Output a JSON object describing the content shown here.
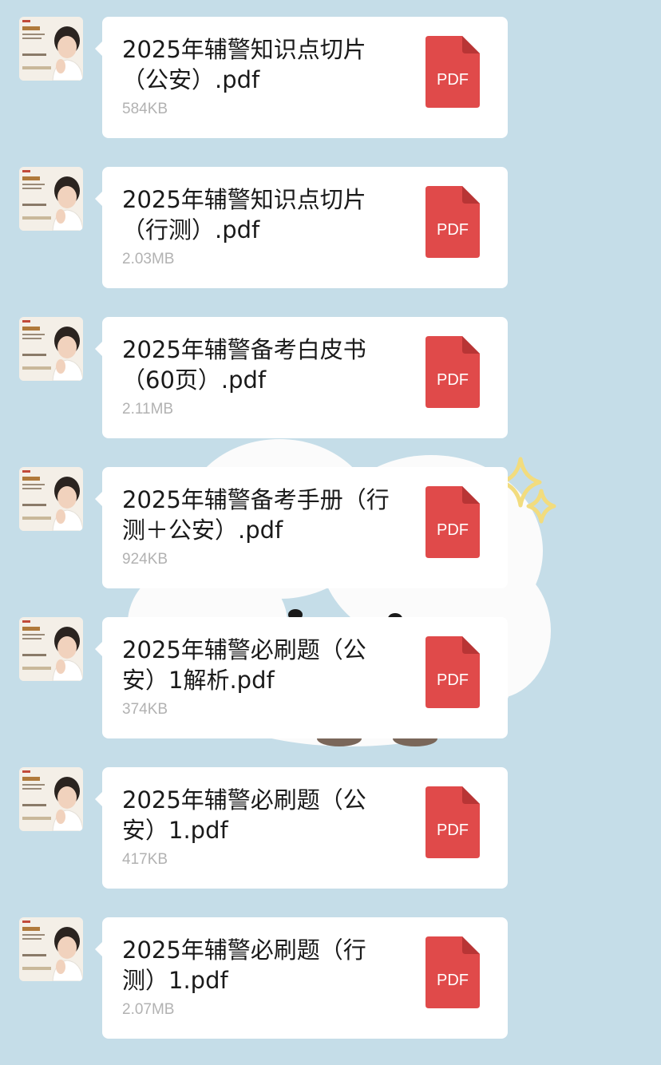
{
  "colors": {
    "background": "#c5dde8",
    "bubble": "#ffffff",
    "pdf_red": "#e04a4a",
    "pdf_fold": "#b83535",
    "size_text": "#b2b2b2",
    "name_text": "#1a1a1a",
    "sparkle": "#f2dc7e"
  },
  "messages": [
    {
      "avatar": "sender-avatar",
      "file_name": "2025年辅警知识点切片（公安）.pdf",
      "file_size": "584KB",
      "file_icon": "pdf-icon",
      "icon_label": "PDF"
    },
    {
      "avatar": "sender-avatar",
      "file_name": "2025年辅警知识点切片（行测）.pdf",
      "file_size": "2.03MB",
      "file_icon": "pdf-icon",
      "icon_label": "PDF"
    },
    {
      "avatar": "sender-avatar",
      "file_name": "2025年辅警备考白皮书（60页）.pdf",
      "file_size": "2.11MB",
      "file_icon": "pdf-icon",
      "icon_label": "PDF"
    },
    {
      "avatar": "sender-avatar",
      "file_name": "2025年辅警备考手册（行测＋公安）.pdf",
      "file_size": "924KB",
      "file_icon": "pdf-icon",
      "icon_label": "PDF"
    },
    {
      "avatar": "sender-avatar",
      "file_name": "2025年辅警必刷题（公安）1解析.pdf",
      "file_size": "374KB",
      "file_icon": "pdf-icon",
      "icon_label": "PDF"
    },
    {
      "avatar": "sender-avatar",
      "file_name": "2025年辅警必刷题（公安）1.pdf",
      "file_size": "417KB",
      "file_icon": "pdf-icon",
      "icon_label": "PDF"
    },
    {
      "avatar": "sender-avatar",
      "file_name": "2025年辅警必刷题（行测）1.pdf",
      "file_size": "2.07MB",
      "file_icon": "pdf-icon",
      "icon_label": "PDF"
    }
  ]
}
